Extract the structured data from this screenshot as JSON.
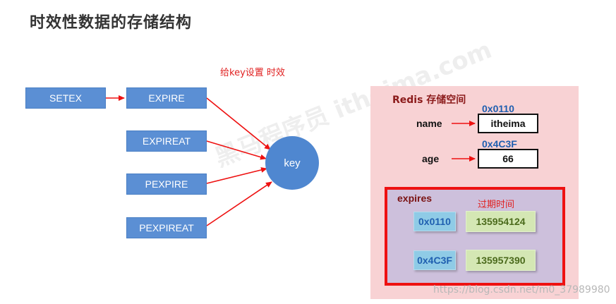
{
  "title": "时效性数据的存储结构",
  "annotation": "给key设置 时效",
  "commands": {
    "setex": "SETEX",
    "expire": "EXPIRE",
    "expireat": "EXPIREAT",
    "pexpire": "PEXPIRE",
    "pexpireat": "PEXPIREAT"
  },
  "key_label": "key",
  "redis_space": {
    "title": "Redis 存储空间",
    "entries": [
      {
        "field": "name",
        "address": "0x0110",
        "value": "itheima"
      },
      {
        "field": "age",
        "address": "0x4C3F",
        "value": "66"
      }
    ]
  },
  "expires": {
    "label": "expires",
    "note": "过期时间",
    "rows": [
      {
        "address": "0x0110",
        "timestamp": "135954124"
      },
      {
        "address": "0x4C3F",
        "timestamp": "135957390"
      }
    ]
  },
  "watermark_bg": "黑马程序员 itheima.com",
  "watermark_url": "https://blog.csdn.net/m0_37989980",
  "colors": {
    "command_box": "#5b8fd4",
    "key_circle": "#4f87d0",
    "arrow": "#ee1111",
    "redis_panel": "#f8d2d4",
    "expires_box": "#cdc0dc",
    "address_cell": "#8fcbe6",
    "timestamp_cell": "#d4e7b4"
  }
}
